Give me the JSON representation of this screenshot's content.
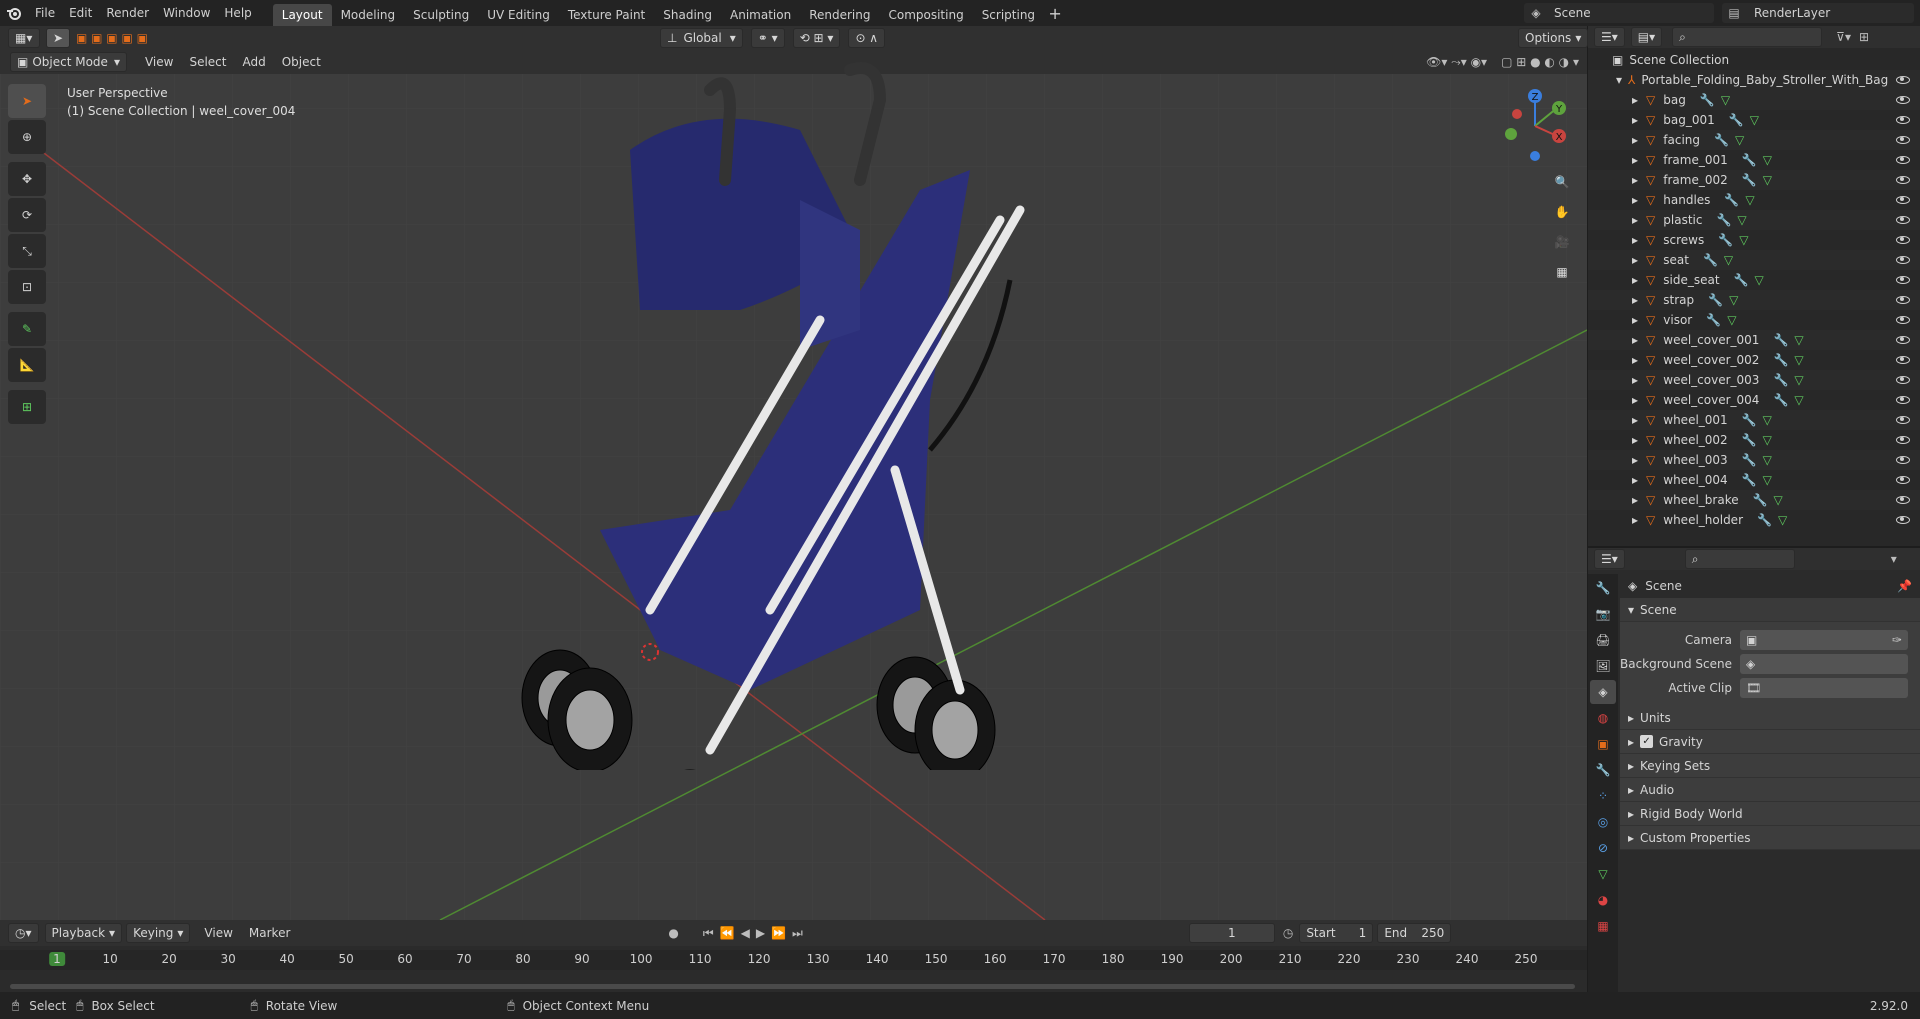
{
  "top_menu": {
    "items": [
      "File",
      "Edit",
      "Render",
      "Window",
      "Help"
    ]
  },
  "workspaces": {
    "tabs": [
      "Layout",
      "Modeling",
      "Sculpting",
      "UV Editing",
      "Texture Paint",
      "Shading",
      "Animation",
      "Rendering",
      "Compositing",
      "Scripting"
    ],
    "active": "Layout"
  },
  "scene_selector": {
    "value": "Scene"
  },
  "render_layer": {
    "value": "RenderLayer"
  },
  "viewport_header": {
    "mode": "Object Mode",
    "menus": [
      "View",
      "Select",
      "Add",
      "Object"
    ],
    "orientation": "Global",
    "options_label": "Options"
  },
  "viewport_info": {
    "line1": "User Perspective",
    "line2": "(1) Scene Collection | weel_cover_004"
  },
  "gizmo": {
    "z": "Z",
    "y": "Y",
    "x": "X"
  },
  "outliner": {
    "root": "Scene Collection",
    "collection": "Portable_Folding_Baby_Stroller_With_Bag",
    "objects": [
      "bag",
      "bag_001",
      "facing",
      "frame_001",
      "frame_002",
      "handles",
      "plastic",
      "screws",
      "seat",
      "side_seat",
      "strap",
      "visor",
      "weel_cover_001",
      "weel_cover_002",
      "weel_cover_003",
      "weel_cover_004",
      "wheel_001",
      "wheel_002",
      "wheel_003",
      "wheel_004",
      "wheel_brake",
      "wheel_holder"
    ]
  },
  "properties": {
    "context_title": "Scene",
    "panel_title": "Scene",
    "fields": [
      {
        "label": "Camera"
      },
      {
        "label": "Background Scene"
      },
      {
        "label": "Active Clip"
      }
    ],
    "sections": [
      "Units",
      "Gravity",
      "Keying Sets",
      "Audio",
      "Rigid Body World",
      "Custom Properties"
    ]
  },
  "timeline": {
    "menus": [
      "Playback",
      "Keying",
      "View",
      "Marker"
    ],
    "current_frame": "1",
    "start_label": "Start",
    "start": "1",
    "end_label": "End",
    "end": "250",
    "ticks": [
      "1",
      "10",
      "20",
      "30",
      "40",
      "50",
      "60",
      "70",
      "80",
      "90",
      "100",
      "110",
      "120",
      "130",
      "140",
      "150",
      "160",
      "170",
      "180",
      "190",
      "200",
      "210",
      "220",
      "230",
      "240",
      "250"
    ]
  },
  "status_bar": {
    "select": "Select",
    "box_select": "Box Select",
    "rotate_view": "Rotate View",
    "context_menu": "Object Context Menu",
    "version": "2.92.0"
  },
  "colors": {
    "accent": "#e36c1b",
    "active_tab": "#474747",
    "stroller_fabric": "#2c2f7a",
    "x_axis": "#c8443f",
    "y_axis": "#5ea33d",
    "z_axis": "#3a7ede"
  }
}
